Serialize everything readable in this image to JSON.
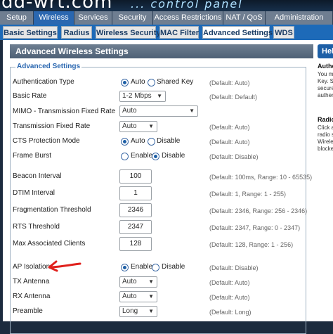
{
  "brand": {
    "logo": "dd-wrt.com",
    "subtitle": "... control panel"
  },
  "main_tabs": [
    {
      "label": "Setup",
      "active": false
    },
    {
      "label": "Wireless",
      "active": true
    },
    {
      "label": "Services",
      "active": false
    },
    {
      "label": "Security",
      "active": false
    },
    {
      "label": "Access Restrictions",
      "active": false
    },
    {
      "label": "NAT / QoS",
      "active": false
    },
    {
      "label": "Administration",
      "active": false
    }
  ],
  "sub_tabs": [
    {
      "label": "Basic Settings",
      "active": false
    },
    {
      "label": "Radius",
      "active": false
    },
    {
      "label": "Wireless Security",
      "active": false
    },
    {
      "label": "MAC Filter",
      "active": false
    },
    {
      "label": "Advanced Settings",
      "active": true
    },
    {
      "label": "WDS",
      "active": false
    }
  ],
  "panel": {
    "title": "Advanced Wireless Settings",
    "legend": "Advanced Settings"
  },
  "settings": {
    "auth_type": {
      "label": "Authentication Type",
      "options": [
        "Auto",
        "Shared Key"
      ],
      "selected": "Auto",
      "default": "(Default: Auto)"
    },
    "basic_rate": {
      "label": "Basic Rate",
      "value": "1-2 Mbps",
      "default": "(Default: Default)"
    },
    "mimo_rate": {
      "label": "MIMO - Transmission Fixed Rate",
      "value": "Auto"
    },
    "tx_fixed_rate": {
      "label": "Transmission Fixed Rate",
      "value": "Auto",
      "default": "(Default: Auto)"
    },
    "cts": {
      "label": "CTS Protection Mode",
      "options": [
        "Auto",
        "Disable"
      ],
      "selected": "Auto",
      "default": "(Default: Auto)"
    },
    "frame_burst": {
      "label": "Frame Burst",
      "options": [
        "Enable",
        "Disable"
      ],
      "selected": "Disable",
      "default": "(Default: Disable)"
    },
    "beacon": {
      "label": "Beacon Interval",
      "value": "100",
      "default": "(Default: 100ms, Range: 10 - 65535)"
    },
    "dtim": {
      "label": "DTIM Interval",
      "value": "1",
      "default": "(Default: 1, Range: 1 - 255)"
    },
    "frag": {
      "label": "Fragmentation Threshold",
      "value": "2346",
      "default": "(Default: 2346, Range: 256 - 2346)"
    },
    "rts": {
      "label": "RTS Threshold",
      "value": "2347",
      "default": "(Default: 2347, Range: 0 - 2347)"
    },
    "max_clients": {
      "label": "Max Associated Clients",
      "value": "128",
      "default": "(Default: 128, Range: 1 - 256)"
    },
    "ap_isolation": {
      "label": "AP Isolation",
      "options": [
        "Enable",
        "Disable"
      ],
      "selected": "Enable",
      "default": "(Default: Disable)"
    },
    "tx_antenna": {
      "label": "TX Antenna",
      "value": "Auto",
      "default": "(Default: Auto)"
    },
    "rx_antenna": {
      "label": "RX Antenna",
      "value": "Auto",
      "default": "(Default: Auto)"
    },
    "preamble": {
      "label": "Preamble",
      "value": "Long",
      "default": "(Default: Long)"
    }
  },
  "help": {
    "button": "Help",
    "sections": [
      {
        "title": "Authen",
        "lines": [
          "You m",
          "Key. S",
          "secure",
          "authen"
        ]
      },
      {
        "title": "Radio",
        "lines": [
          "Click a",
          "radio s",
          "Wirele",
          "blocke"
        ]
      }
    ]
  },
  "colors": {
    "accent": "#1d6ab8",
    "active_tab": "#2a67b0",
    "arrow": "#e0201c"
  }
}
